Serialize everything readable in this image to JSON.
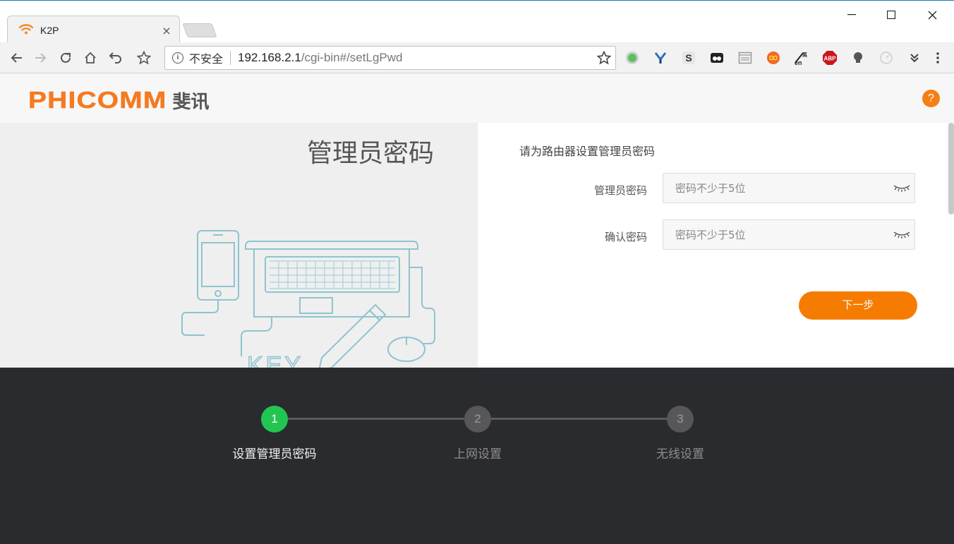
{
  "browser": {
    "tab_title": "K2P",
    "tab_close": "×",
    "window_controls": {
      "minimize": "—",
      "maximize": "☐",
      "close": "✕"
    },
    "omnibox": {
      "info": "i",
      "security_label": "不安全",
      "host": "192.168.2.1",
      "path": "/cgi-bin#/setLgPwd"
    },
    "extensions": [
      "green-circle",
      "y-leaf",
      "s-box",
      "eyes",
      "window",
      "infinity",
      "translate-en",
      "ABP",
      "lightbulb",
      "gauge",
      "double-chevron",
      "more-menu"
    ],
    "abp_label": "ABP"
  },
  "header": {
    "logo_en": "PHICOMM",
    "logo_cn": "斐讯",
    "help": "?"
  },
  "left_panel": {
    "title": "管理员密码",
    "illustration_text": "KEY"
  },
  "form": {
    "subtitle": "请为路由器设置管理员密码",
    "password": {
      "label": "管理员密码",
      "placeholder": "密码不少于5位"
    },
    "confirm": {
      "label": "确认密码",
      "placeholder": "密码不少于5位"
    },
    "next_button": "下一步"
  },
  "steps": [
    {
      "number": "1",
      "label": "设置管理员密码",
      "state": "active"
    },
    {
      "number": "2",
      "label": "上网设置",
      "state": "inactive"
    },
    {
      "number": "3",
      "label": "无线设置",
      "state": "inactive"
    }
  ],
  "colors": {
    "brand_orange": "#f47b20",
    "button_orange": "#f57c00",
    "step_active": "#23c552",
    "footer_bg": "#2a2b2f"
  }
}
